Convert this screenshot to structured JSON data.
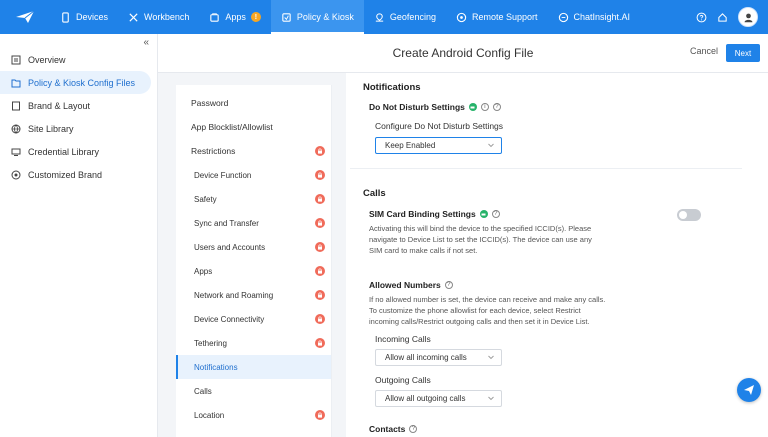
{
  "topnav": {
    "items": [
      {
        "label": "Devices",
        "icon": "device-icon"
      },
      {
        "label": "Workbench",
        "icon": "tools-icon"
      },
      {
        "label": "Apps",
        "icon": "apps-icon",
        "badge": "!"
      },
      {
        "label": "Policy & Kiosk",
        "icon": "shield-icon",
        "active": true
      },
      {
        "label": "Geofencing",
        "icon": "geofence-icon"
      },
      {
        "label": "Remote Support",
        "icon": "remote-icon"
      },
      {
        "label": "ChatInsight.AI",
        "icon": "chat-icon"
      }
    ]
  },
  "sidebar": {
    "collapse_glyph": "«",
    "items": [
      {
        "label": "Overview",
        "icon": "overview-icon"
      },
      {
        "label": "Policy & Kiosk Config Files",
        "icon": "config-files-icon",
        "active": true
      },
      {
        "label": "Brand & Layout",
        "icon": "brand-icon"
      },
      {
        "label": "Site Library",
        "icon": "site-icon"
      },
      {
        "label": "Credential Library",
        "icon": "credential-icon"
      },
      {
        "label": "Customized Brand",
        "icon": "custom-brand-icon"
      }
    ]
  },
  "header": {
    "title": "Create Android Config File",
    "cancel_label": "Cancel",
    "next_label": "Next"
  },
  "submenu": {
    "items": [
      {
        "label": "Password",
        "child": false,
        "lock": false
      },
      {
        "label": "App Blocklist/Allowlist",
        "child": false,
        "lock": false
      },
      {
        "label": "Restrictions",
        "child": false,
        "lock": true
      },
      {
        "label": "Device Function",
        "child": true,
        "lock": true
      },
      {
        "label": "Safety",
        "child": true,
        "lock": true
      },
      {
        "label": "Sync and Transfer",
        "child": true,
        "lock": true
      },
      {
        "label": "Users and Accounts",
        "child": true,
        "lock": true
      },
      {
        "label": "Apps",
        "child": true,
        "lock": true
      },
      {
        "label": "Network and Roaming",
        "child": true,
        "lock": true
      },
      {
        "label": "Device Connectivity",
        "child": true,
        "lock": true
      },
      {
        "label": "Tethering",
        "child": true,
        "lock": true
      },
      {
        "label": "Notifications",
        "child": true,
        "lock": false,
        "active": true
      },
      {
        "label": "Calls",
        "child": true,
        "lock": false
      },
      {
        "label": "Location",
        "child": true,
        "lock": true
      }
    ]
  },
  "form": {
    "notifications": {
      "section_title": "Notifications",
      "dnd_title": "Do Not Disturb Settings",
      "dnd_label": "Configure Do Not Disturb Settings",
      "dnd_value": "Keep Enabled"
    },
    "calls": {
      "section_title": "Calls",
      "sim_title": "SIM Card Binding Settings",
      "sim_desc_1": "Activating this will bind the device to the specified ICCID(s). Please",
      "sim_desc_2": "navigate to Device List to set the ICCID(s). The device can use any",
      "sim_desc_3": "SIM card to make calls if not set.",
      "sim_enabled": false,
      "allowed_title": "Allowed Numbers",
      "allowed_desc_1": "If no allowed number is set, the device can receive and make any calls.",
      "allowed_desc_2": "To customize the phone allowlist for each device, select Restrict",
      "allowed_desc_3": "incoming calls/Restrict outgoing calls and then set it in Device List.",
      "incoming_label": "Incoming Calls",
      "incoming_value": "Allow all incoming calls",
      "outgoing_label": "Outgoing Calls",
      "outgoing_value": "Allow all outgoing calls"
    },
    "contacts": {
      "section_title": "Contacts"
    }
  },
  "colors": {
    "brand": "#1f82e8",
    "lock": "#f06b5a",
    "green": "#27b36a"
  }
}
